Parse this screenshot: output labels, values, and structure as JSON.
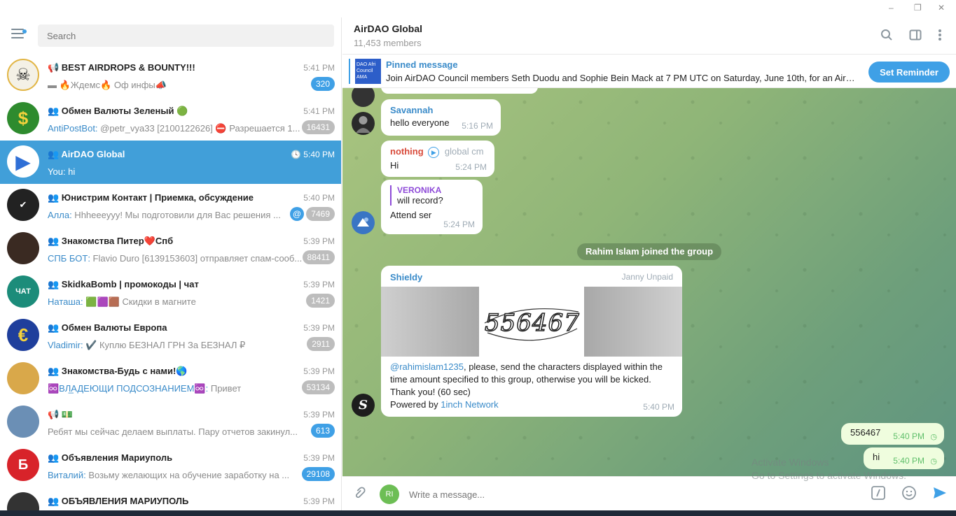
{
  "window": {
    "minimize": "–",
    "restore": "❐",
    "close": "✕"
  },
  "sidebar": {
    "search_placeholder": "Search",
    "chats": [
      {
        "title": "📢 BEST AIRDROPS & BOUNTY!!!",
        "time": "5:41 PM",
        "sender": "",
        "preview": "▬ 🔥Ждемс🔥 Оф инфы📣",
        "badge": "320",
        "badge_color": "blue",
        "avatar_color": "#f4f1e6",
        "avatar_label": "☠"
      },
      {
        "title": "👥 Обмен Валюты Зеленый 🟢",
        "time": "5:41 PM",
        "sender": "AntiPostBot:",
        "preview": " @petr_vya33 [2100122626] ⛔ Разрешается 1...",
        "badge": "16431",
        "badge_color": "grey",
        "avatar_color": "#2e8b2e",
        "avatar_label": "$"
      },
      {
        "title": "👥 AirDAO Global",
        "time": "🕓 5:40 PM",
        "sender": "",
        "preview": "You: hi",
        "badge": "",
        "badge_color": "",
        "avatar_color": "#ffffff",
        "avatar_label": "▶"
      },
      {
        "title": "👥 Юнистрим Контакт | Приемка, обсуждение",
        "time": "5:40 PM",
        "sender": "Алла:",
        "preview": " Hhheeeyyy!  Мы подготовили для Вас решения ...",
        "badge": "7469",
        "badge_color": "grey",
        "avatar_color": "#222222",
        "avatar_label": "✔"
      },
      {
        "title": "👥 Знакомства Питер❤️Спб",
        "time": "5:39 PM",
        "sender": "СПБ БОТ:",
        "preview": " Flavio Duro [6139153603] отправляет спам-сооб...",
        "badge": "88411",
        "badge_color": "grey",
        "avatar_color": "#3a2a22",
        "avatar_label": ""
      },
      {
        "title": "👥 SkidkaBomb | промокоды | чат",
        "time": "5:39 PM",
        "sender": "Наташа:",
        "preview": " 🟩🟪🟫  Скидки в магните",
        "badge": "1421",
        "badge_color": "grey",
        "avatar_color": "#1c8c7a",
        "avatar_label": "ЧАТ"
      },
      {
        "title": "👥 Обмен Валюты Европа",
        "time": "5:39 PM",
        "sender": "Vladimir:",
        "preview": " ✔️  Куплю  БЕЗНАЛ ГРН        За БЕЗНАЛ ₽",
        "badge": "2911",
        "badge_color": "grey",
        "avatar_color": "#1f3f9c",
        "avatar_label": "€"
      },
      {
        "title": "👥 Знакомства-Будь с нами!🌎",
        "time": "5:39 PM",
        "sender": "♾️ВЛ̲АДЕЮЩИ ПОДСОЗНАНИЕМ♾️:",
        "preview": " Привет",
        "badge": "53134",
        "badge_color": "grey",
        "avatar_color": "#d9a84a",
        "avatar_label": ""
      },
      {
        "title": "📢 💵",
        "time": "5:39 PM",
        "sender": "",
        "preview": "Ребят мы сейчас делаем выплаты. Пару отчетов закинул...",
        "badge": "613",
        "badge_color": "blue",
        "avatar_color": "#6b8fb5",
        "avatar_label": ""
      },
      {
        "title": "👥 Объявления Мариуполь",
        "time": "5:39 PM",
        "sender": "Виталий:",
        "preview": " Возьму желающих на обучение заработку на ...",
        "badge": "29108",
        "badge_color": "blue",
        "avatar_color": "#d8232a",
        "avatar_label": "Б"
      },
      {
        "title": "👥 ОБЪЯВЛЕНИЯ МАРИУПОЛЬ",
        "time": "5:39 PM",
        "sender": "",
        "preview": "",
        "badge": "",
        "badge_color": "",
        "avatar_color": "#333333",
        "avatar_label": ""
      }
    ]
  },
  "header": {
    "title": "AirDAO Global",
    "subtitle": "11,453 members"
  },
  "pinned": {
    "title": "Pinned message",
    "text": "Join AirDAO Council members Seth Duodu and Sophie Bein Mack at 7 PM UTC on Saturday, June 10th, for an AirS...",
    "thumb_text": "DAO Afri Council AMA",
    "button": "Set Reminder"
  },
  "messages": {
    "m1": {
      "author": "Savannah",
      "author_color": "#3a8bc9",
      "text": "hello everyone",
      "time": "5:16 PM"
    },
    "m2": {
      "author": "nothing",
      "author_color": "#d84a3a",
      "via": "global cm",
      "text": "Hi",
      "time": "5:24 PM"
    },
    "m3": {
      "reply_author": "VERONIKA",
      "reply_text": "will record?",
      "text": "Attend ser",
      "time": "5:24 PM"
    },
    "service": "Rahim Islam joined the group",
    "m4": {
      "author": "Shieldy",
      "tag": "Janny Unpaid",
      "captcha": "556467",
      "mention": "@rahimislam1235",
      "text1": ", please, send the characters displayed within the time amount specified to this group, otherwise you will be kicked.",
      "text2": "Thank you! (60 sec)",
      "powered": "Powered by ",
      "link": "1inch Network",
      "time": "5:40 PM",
      "avatar_label": "S"
    },
    "out1": {
      "text": "556467",
      "time": "5:40 PM"
    },
    "out2": {
      "text": "hi",
      "time": "5:40 PM"
    }
  },
  "composer": {
    "placeholder": "Write a message...",
    "avatar_initials": "RI"
  },
  "watermark": {
    "line1": "Activate Windows",
    "line2": "Go to Settings to activate Windows."
  }
}
